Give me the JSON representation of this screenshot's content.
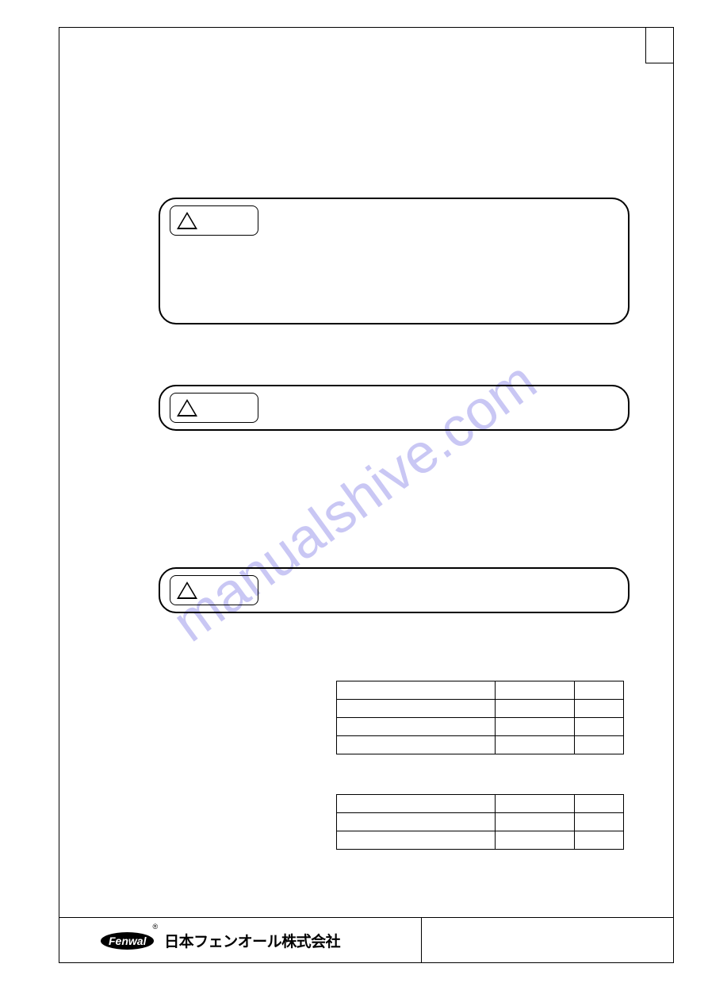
{
  "watermark_text": "manualshive.com",
  "logo": {
    "pill_text": "Fenwal",
    "registered": "®",
    "company_jp": "日本フェンオール株式会社"
  },
  "tables": {
    "t1": {
      "rows": [
        [
          "",
          "",
          ""
        ],
        [
          "",
          "",
          ""
        ],
        [
          "",
          "",
          ""
        ],
        [
          "",
          "",
          ""
        ]
      ]
    },
    "t2": {
      "rows": [
        [
          "",
          "",
          ""
        ],
        [
          "",
          "",
          ""
        ],
        [
          "",
          "",
          ""
        ]
      ]
    }
  }
}
